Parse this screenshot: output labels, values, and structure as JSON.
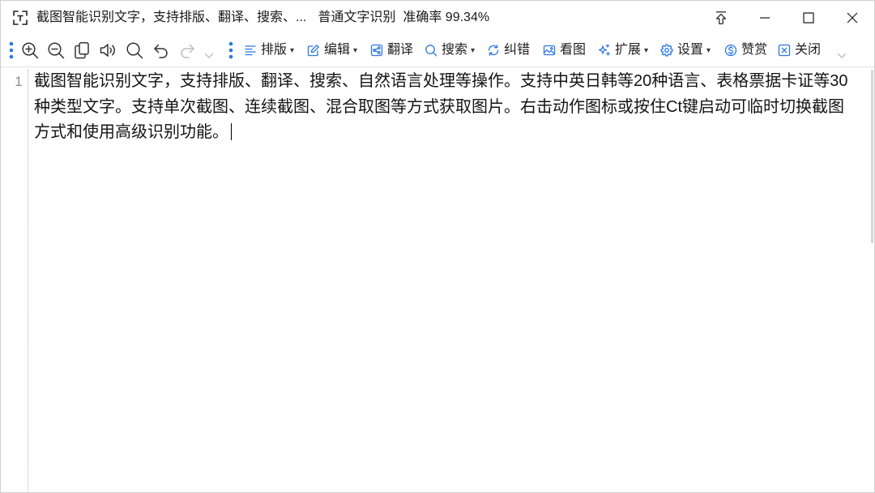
{
  "window": {
    "app_icon": "scan-text-icon",
    "title": "截图智能识别文字，支持排版、翻译、搜索、...",
    "mode": "普通文字识别",
    "accuracy": "准确率 99.34%",
    "controls": [
      "pin-top-icon",
      "minimize-icon",
      "maximize-icon",
      "close-icon"
    ]
  },
  "toolbar": {
    "quick_actions": [
      {
        "icon": "zoom-in-icon",
        "enabled": true
      },
      {
        "icon": "zoom-out-icon",
        "enabled": true
      },
      {
        "icon": "copy-icon",
        "enabled": true
      },
      {
        "icon": "speaker-icon",
        "enabled": true
      },
      {
        "icon": "search-icon",
        "enabled": true
      },
      {
        "icon": "undo-icon",
        "enabled": true
      },
      {
        "icon": "redo-icon",
        "enabled": false
      },
      {
        "icon": "chevron-down-icon",
        "enabled": false
      }
    ],
    "dropdown_glyph": "▾",
    "menus": [
      {
        "label": "排版",
        "icon": "align-list-icon",
        "dropdown": true
      },
      {
        "label": "编辑",
        "icon": "edit-icon",
        "dropdown": true
      },
      {
        "label": "翻译",
        "icon": "translate-icon",
        "dropdown": false
      },
      {
        "label": "搜索",
        "icon": "search-icon",
        "dropdown": true
      },
      {
        "label": "纠错",
        "icon": "refresh-icon",
        "dropdown": false
      },
      {
        "label": "看图",
        "icon": "image-icon",
        "dropdown": false
      },
      {
        "label": "扩展",
        "icon": "sparkle-icon",
        "dropdown": true
      },
      {
        "label": "设置",
        "icon": "gear-icon",
        "dropdown": true
      },
      {
        "label": "赞赏",
        "icon": "dollar-circle-icon",
        "dropdown": false
      },
      {
        "label": "关闭",
        "icon": "close-box-icon",
        "dropdown": false
      }
    ],
    "overflow_icon": "chevron-down-icon"
  },
  "editor": {
    "line_numbers": [
      "1"
    ],
    "lines": [
      "截图智能识别文字，支持排版、翻译、搜索、自然语言处理等操作。支持中英日韩等20种语言、表格票据卡证等30",
      "种类型文字。支持单次截图、连续截图、混合取图等方式获取图片。右击动作图标或按住Ct键启动可临时切换截图",
      "方式和使用高级识别功能。"
    ]
  },
  "colors": {
    "accent": "#2b78e4",
    "icon": "#333333",
    "icon_disabled": "#bdbdbd",
    "text": "#141414",
    "gutter": "#8c8c8c",
    "background": "#ffffff"
  }
}
